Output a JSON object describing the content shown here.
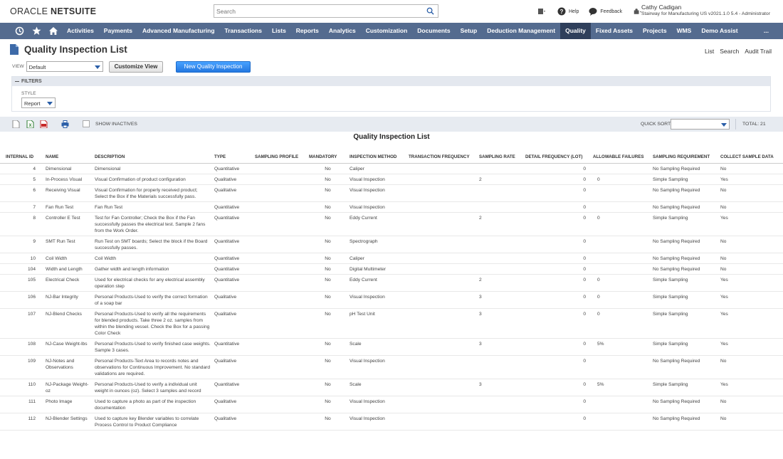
{
  "header": {
    "logo_oracle": "ORACLE",
    "logo_netsuite": "NETSUITE",
    "search_placeholder": "Search",
    "help": "Help",
    "feedback": "Feedback",
    "user_name": "Cathy Cadigan",
    "user_role": "Stairway for Manufacturing US v2021.1.0 5.4 - Administrator"
  },
  "nav": {
    "items": [
      "Activities",
      "Payments",
      "Advanced Manufacturing",
      "Transactions",
      "Lists",
      "Reports",
      "Analytics",
      "Customization",
      "Documents",
      "Setup",
      "Deduction Management",
      "Quality",
      "Fixed Assets",
      "Projects",
      "WMS",
      "Demo Assist"
    ],
    "active": "Quality",
    "more": "..."
  },
  "page": {
    "title": "Quality Inspection List",
    "links": [
      "List",
      "Search",
      "Audit Trail"
    ],
    "view_label": "VIEW",
    "view_value": "Default",
    "customize_view": "Customize View",
    "new_button": "New Quality Inspection",
    "filters_label": "FILTERS",
    "style_label": "STYLE",
    "style_value": "Report",
    "show_inactives": "SHOW INACTIVES",
    "quick_sort": "QUICK SORT",
    "total": "TOTAL: 21",
    "list_title": "Quality Inspection List"
  },
  "table": {
    "columns": [
      "INTERNAL ID",
      "NAME",
      "DESCRIPTION",
      "TYPE",
      "SAMPLING PROFILE",
      "MANDATORY",
      "INSPECTION METHOD",
      "TRANSACTION FREQUENCY",
      "SAMPLING RATE",
      "DETAIL FREQUENCY (LOT)",
      "ALLOWABLE FAILURES",
      "SAMPLING REQUIREMENT",
      "COLLECT SAMPLE DATA"
    ],
    "rows": [
      {
        "id": "4",
        "name": "Dimensional",
        "desc": "Dimensional",
        "type": "Quantitative",
        "mandatory": "No",
        "method": "Caliper",
        "rate": "",
        "detail": "0",
        "fail": "",
        "req": "No Sampling Required",
        "collect": "No"
      },
      {
        "id": "5",
        "name": "In-Process Visual",
        "desc": "Visual Confirmation of product configuration",
        "type": "Qualitative",
        "mandatory": "No",
        "method": "Visual Inspection",
        "rate": "2",
        "detail": "0",
        "fail": "0",
        "req": "Simple Sampling",
        "collect": "Yes"
      },
      {
        "id": "6",
        "name": "Receiving Visual",
        "desc": "Visual Confirmation for properly received product; Select the Box if the Materials successfully pass.",
        "type": "Qualitative",
        "mandatory": "No",
        "method": "Visual Inspection",
        "rate": "",
        "detail": "0",
        "fail": "",
        "req": "No Sampling Required",
        "collect": "No"
      },
      {
        "id": "7",
        "name": "Fan Run Test",
        "desc": "Fan Run Test",
        "type": "Quantitative",
        "mandatory": "No",
        "method": "Visual Inspection",
        "rate": "",
        "detail": "0",
        "fail": "",
        "req": "No Sampling Required",
        "collect": "No"
      },
      {
        "id": "8",
        "name": "Controller E Test",
        "desc": "Test for Fan Controller; Check the Box if the Fan successfully passes the electrical test. Sample 2 fans from the Work Order.",
        "type": "Quantitative",
        "mandatory": "No",
        "method": "Eddy Current",
        "rate": "2",
        "detail": "0",
        "fail": "0",
        "req": "Simple Sampling",
        "collect": "Yes"
      },
      {
        "id": "9",
        "name": "SMT Run Test",
        "desc": "Run Test on SMT boards; Select the block if the Board successfully passes.",
        "type": "Quantitative",
        "mandatory": "No",
        "method": "Spectrograph",
        "rate": "",
        "detail": "0",
        "fail": "",
        "req": "No Sampling Required",
        "collect": "No"
      },
      {
        "id": "10",
        "name": "Coil Width",
        "desc": "Coil Width",
        "type": "Quantitative",
        "mandatory": "No",
        "method": "Caliper",
        "rate": "",
        "detail": "0",
        "fail": "",
        "req": "No Sampling Required",
        "collect": "No"
      },
      {
        "id": "104",
        "name": "Width and Length",
        "desc": "Gather width and length information",
        "type": "Quantitative",
        "mandatory": "No",
        "method": "Digital Multimeter",
        "rate": "",
        "detail": "0",
        "fail": "",
        "req": "No Sampling Required",
        "collect": "No"
      },
      {
        "id": "105",
        "name": "Electrical Check",
        "desc": "Used for electrical checks for any electrical assembly operation step",
        "type": "Quantitative",
        "mandatory": "No",
        "method": "Eddy Current",
        "rate": "2",
        "detail": "0",
        "fail": "0",
        "req": "Simple Sampling",
        "collect": "Yes"
      },
      {
        "id": "106",
        "name": "NJ-Bar Integrity",
        "desc": "Personal Products-Used to verify the correct formation of a soap bar",
        "type": "Qualitative",
        "mandatory": "No",
        "method": "Visual Inspection",
        "rate": "3",
        "detail": "0",
        "fail": "0",
        "req": "Simple Sampling",
        "collect": "Yes"
      },
      {
        "id": "107",
        "name": "NJ-Blend Checks",
        "desc": "Personal Products-Used to verify all the requirements for blended products. Take three 2 oz. samples from within the blending vessel. Check the Box for a passing Color Check",
        "type": "Qualitative",
        "mandatory": "No",
        "method": "pH Test Unit",
        "rate": "3",
        "detail": "0",
        "fail": "0",
        "req": "Simple Sampling",
        "collect": "Yes"
      },
      {
        "id": "108",
        "name": "NJ-Case Weight-lbs",
        "desc": "Personal Products-Used to verify finished case weights. Sample 3 cases.",
        "type": "Quantitative",
        "mandatory": "No",
        "method": "Scale",
        "rate": "3",
        "detail": "0",
        "fail": "5%",
        "req": "Simple Sampling",
        "collect": "Yes"
      },
      {
        "id": "109",
        "name": "NJ-Notes and Observations",
        "desc": "Personal Products-Text Area to records notes and observations for Continuous Improvement. No standard validations are required.",
        "type": "Qualitative",
        "mandatory": "No",
        "method": "Visual Inspection",
        "rate": "",
        "detail": "0",
        "fail": "",
        "req": "No Sampling Required",
        "collect": "No"
      },
      {
        "id": "110",
        "name": "NJ-Package Weight-oz",
        "desc": "Personal Products-Used to verify a individual unit weight in ounces (oz). Select 3 samples and record",
        "type": "Quantitative",
        "mandatory": "No",
        "method": "Scale",
        "rate": "3",
        "detail": "0",
        "fail": "5%",
        "req": "Simple Sampling",
        "collect": "Yes"
      },
      {
        "id": "111",
        "name": "Photo Image",
        "desc": "Used to capture a photo as part of the inspection documentation",
        "type": "Qualitative",
        "mandatory": "No",
        "method": "Visual Inspection",
        "rate": "",
        "detail": "0",
        "fail": "",
        "req": "No Sampling Required",
        "collect": "No"
      },
      {
        "id": "112",
        "name": "NJ-Blender Settings",
        "desc": "Used to capture key Blender variables to correlate Process Control to Product Compliance",
        "type": "Qualitative",
        "mandatory": "No",
        "method": "Visual Inspection",
        "rate": "",
        "detail": "0",
        "fail": "",
        "req": "No Sampling Required",
        "collect": "No"
      }
    ]
  },
  "colors": {
    "nav_bg": "#546b8f",
    "nav_active": "#2f3f5b",
    "primary_button": "#2477e0",
    "toolbar_bg": "#e7ebf1"
  }
}
